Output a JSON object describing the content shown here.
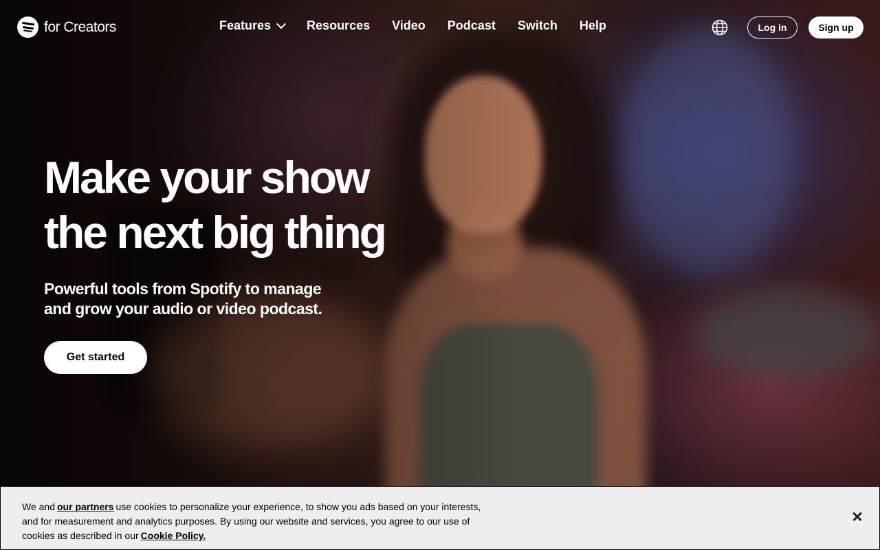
{
  "brand": {
    "logo_text": "for Creators",
    "logo_icon": "spotify-logo-icon"
  },
  "nav": {
    "items": [
      {
        "label": "Features",
        "has_dropdown": true
      },
      {
        "label": "Resources"
      },
      {
        "label": "Video"
      },
      {
        "label": "Podcast"
      },
      {
        "label": "Switch"
      },
      {
        "label": "Help"
      }
    ],
    "language_icon": "globe-icon",
    "login_label": "Log in",
    "signup_label": "Sign up"
  },
  "hero": {
    "headline_line1": "Make your show",
    "headline_line2": "the next big thing",
    "subtext_line1": "Powerful tools from Spotify to manage",
    "subtext_line2": "and grow your audio or video podcast.",
    "cta_label": "Get started",
    "background_image": "woman-holding-phone-photo"
  },
  "cookie_banner": {
    "text_1": "We and",
    "partners_link": "our partners",
    "text_2": "use cookies to personalize your experience, to show you ads based on your interests, and for measurement and analytics purposes. By using our website and services, you agree to our use of cookies as described in our",
    "policy_link": "Cookie Policy.",
    "close_icon": "close-icon"
  },
  "colors": {
    "text_primary": "#ffffff",
    "button_bg": "#ffffff",
    "banner_bg": "#eeeeee"
  }
}
